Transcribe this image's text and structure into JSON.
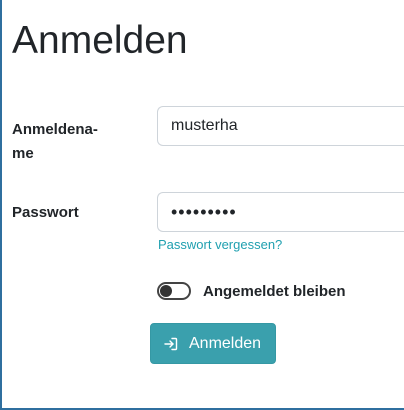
{
  "form": {
    "title": "Anmelden",
    "username_label": "Anmeldena-\nme",
    "username_value": "musterha",
    "password_label": "Passwort",
    "password_value": "musterhas",
    "forgot_link": "Passwort vergessen?",
    "remember_label": "Angemeldet bleiben",
    "remember_checked": false,
    "submit_label": "Anmelden",
    "submit_icon": "sign-in-icon"
  },
  "colors": {
    "accent": "#3aa0ad",
    "link": "#20a0b0",
    "frame": "#2f6f9f"
  }
}
